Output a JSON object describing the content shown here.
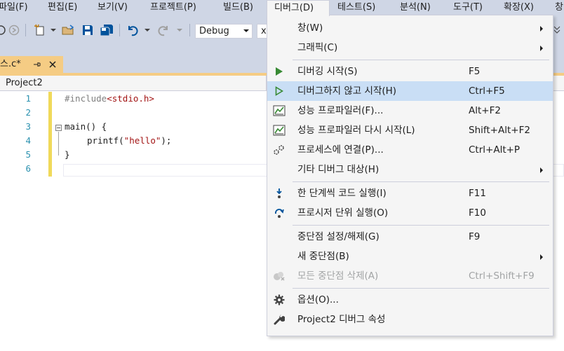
{
  "menubar": {
    "items": [
      {
        "label": "파일(F)"
      },
      {
        "label": "편집(E)"
      },
      {
        "label": "보기(V)"
      },
      {
        "label": "프로젝트(P)"
      },
      {
        "label": "빌드(B)"
      },
      {
        "label": "디버그(D)"
      },
      {
        "label": "테스트(S)"
      },
      {
        "label": "분석(N)"
      },
      {
        "label": "도구(T)"
      },
      {
        "label": "확장(X)"
      },
      {
        "label": "창"
      }
    ],
    "open_item": "디버그(D)"
  },
  "toolbar": {
    "config_value": "Debug",
    "platform_value": "x"
  },
  "tab": {
    "label": "스.c*",
    "pin_icon": "pin-icon",
    "close_icon": "close-icon"
  },
  "navbar": {
    "project": "Project2"
  },
  "editor": {
    "line_numbers": [
      "1",
      "2",
      "3",
      "4",
      "5",
      "6"
    ],
    "lines": {
      "l1_directive": "#include",
      "l1_header": "<stdio.h>",
      "l3": "main() {",
      "l4_call": "printf(",
      "l4_str": "\"hello\"",
      "l4_end": ");",
      "l5": "}"
    }
  },
  "debug_menu": {
    "items": [
      {
        "label": "창(W)",
        "shortcut": "",
        "submenu": true,
        "icon": ""
      },
      {
        "label": "그래픽(C)",
        "shortcut": "",
        "submenu": true,
        "icon": ""
      },
      {
        "label": "디버깅 시작(S)",
        "shortcut": "F5",
        "submenu": false,
        "icon": "play-icon"
      },
      {
        "label": "디버그하지 않고 시작(H)",
        "shortcut": "Ctrl+F5",
        "submenu": false,
        "icon": "play-outline-icon"
      },
      {
        "label": "성능 프로파일러(F)...",
        "shortcut": "Alt+F2",
        "submenu": false,
        "icon": "profiler-icon"
      },
      {
        "label": "성능 프로파일러 다시 시작(L)",
        "shortcut": "Shift+Alt+F2",
        "submenu": false,
        "icon": "profiler-restart-icon"
      },
      {
        "label": "프로세스에 연결(P)...",
        "shortcut": "Ctrl+Alt+P",
        "submenu": false,
        "icon": "attach-process-icon"
      },
      {
        "label": "기타 디버그 대상(H)",
        "shortcut": "",
        "submenu": true,
        "icon": ""
      },
      {
        "label": "한 단계씩 코드 실행(I)",
        "shortcut": "F11",
        "submenu": false,
        "icon": "step-into-icon"
      },
      {
        "label": "프로시저 단위 실행(O)",
        "shortcut": "F10",
        "submenu": false,
        "icon": "step-over-icon"
      },
      {
        "label": "중단점 설정/해제(G)",
        "shortcut": "F9",
        "submenu": false,
        "icon": ""
      },
      {
        "label": "새 중단점(B)",
        "shortcut": "",
        "submenu": true,
        "icon": ""
      },
      {
        "label": "모든 중단점 삭제(A)",
        "shortcut": "Ctrl+Shift+F9",
        "submenu": false,
        "icon": "delete-breakpoints-icon"
      },
      {
        "label": "옵션(O)...",
        "shortcut": "",
        "submenu": false,
        "icon": "gear-icon"
      },
      {
        "label": "Project2 디버그 속성",
        "shortcut": "",
        "submenu": false,
        "icon": "wrench-icon"
      }
    ],
    "highlighted": "디버그하지 않고 시작(H)",
    "disabled": [
      "모든 중단점 삭제(A)"
    ]
  },
  "colors": {
    "chrome": "#cfd6e5",
    "menu_bg": "#f5f5f5",
    "highlight": "#c9def5",
    "tab_active": "#f5cc84",
    "play_green": "#388a34",
    "line_number": "#2b91af",
    "string_red": "#a31515"
  }
}
